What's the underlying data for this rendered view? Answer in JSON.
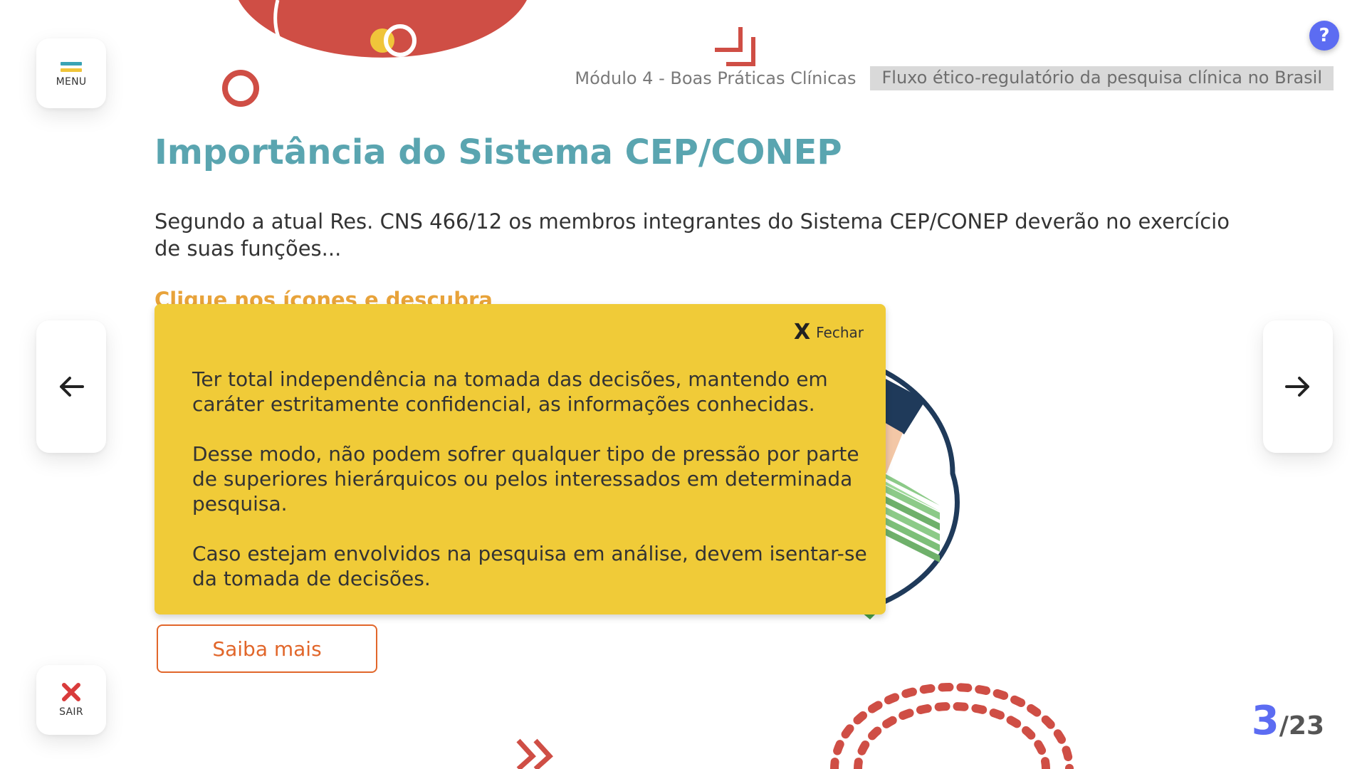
{
  "header": {
    "module": "Módulo 4 - Boas Práticas Clínicas",
    "topic": "Fluxo ético-regulatório da pesquisa clínica no Brasil",
    "help": "?"
  },
  "side": {
    "menu_label": "MENU",
    "exit_label": "SAIR"
  },
  "content": {
    "title": "Importância do Sistema CEP/CONEP",
    "intro": "Segundo a atual Res. CNS 466/12 os membros integrantes do Sistema CEP/CONEP deverão no exercício de suas funções...",
    "hint": "Clique nos ícones e descubra"
  },
  "popup": {
    "close_icon": "X",
    "close_label": "Fechar",
    "paragraphs": [
      "Ter total independência na tomada das decisões, mantendo em caráter estritamente confidencial, as informações conhecidas.",
      "Desse modo, não podem sofrer qualquer tipo de pressão por parte de superiores hierárquicos ou pelos interessados em determinada pesquisa.",
      "Caso estejam envolvidos na pesquisa em análise, devem isentar-se da tomada de decisões."
    ]
  },
  "saiba_mais": "Saiba mais",
  "pager": {
    "current": "3",
    "total": "/23"
  },
  "colors": {
    "accent_teal": "#5aa5b0",
    "popup_yellow": "#f0cb38",
    "brand_red": "#cf4e45",
    "help_blue": "#5c6cf2",
    "button_orange": "#e1662a"
  },
  "icons": [
    "menu-icon",
    "exit-x-icon",
    "arrow-left-icon",
    "arrow-right-icon",
    "help-icon",
    "close-icon"
  ]
}
